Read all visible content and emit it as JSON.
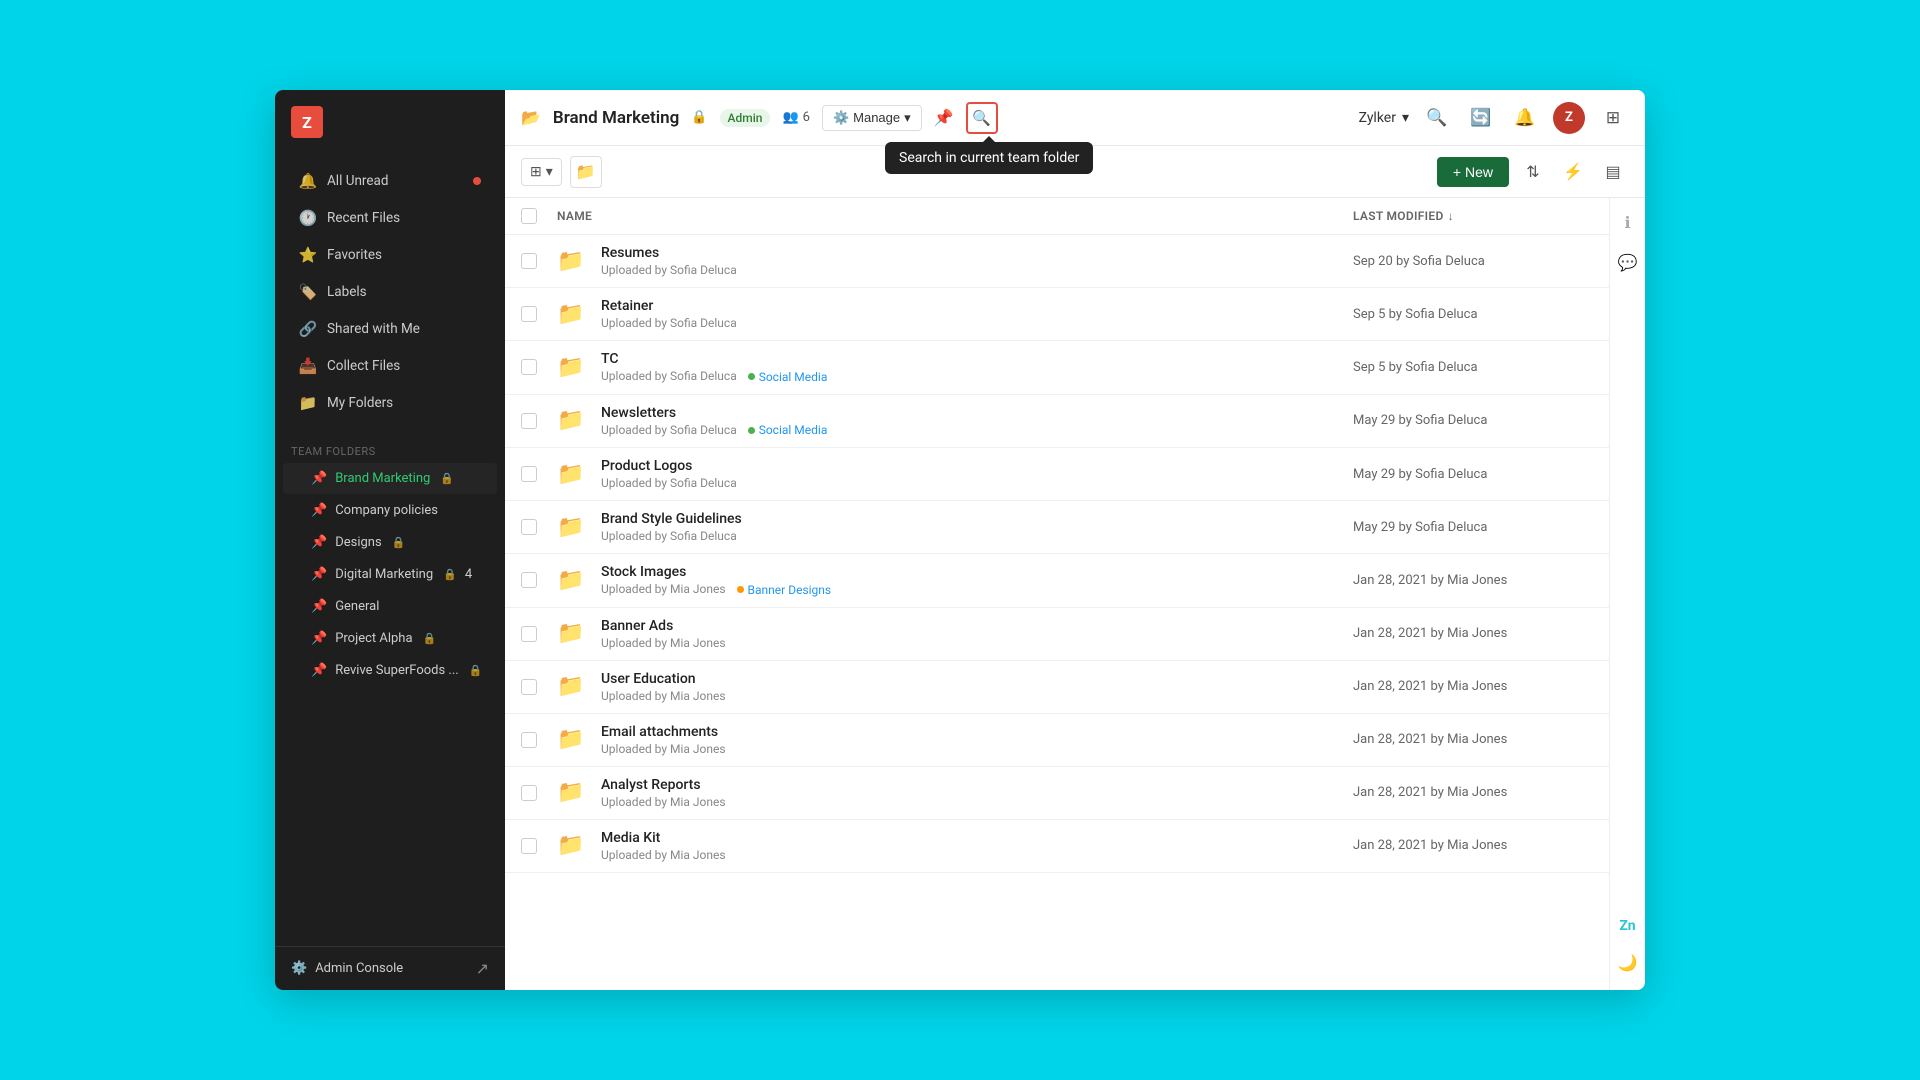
{
  "sidebar": {
    "logo": "Z",
    "nav": [
      {
        "id": "all-unread",
        "label": "All Unread",
        "icon": "🔔",
        "hasDot": true
      },
      {
        "id": "recent-files",
        "label": "Recent Files",
        "icon": "🕐",
        "hasDot": false
      },
      {
        "id": "favorites",
        "label": "Favorites",
        "icon": "⭐",
        "hasDot": false
      },
      {
        "id": "labels",
        "label": "Labels",
        "icon": "🏷️",
        "hasDot": false
      },
      {
        "id": "shared-with-me",
        "label": "Shared with Me",
        "icon": "🔗",
        "hasDot": false
      },
      {
        "id": "collect-files",
        "label": "Collect Files",
        "icon": "📥",
        "hasDot": false
      },
      {
        "id": "my-folders",
        "label": "My Folders",
        "icon": "📁",
        "hasDot": false
      }
    ],
    "team_folders_label": "Team Folders",
    "team_folders": [
      {
        "id": "brand-marketing",
        "label": "Brand Marketing",
        "active": true,
        "hasLock": true,
        "hasBadge": false
      },
      {
        "id": "company-policies",
        "label": "Company policies",
        "active": false,
        "hasLock": false,
        "hasBadge": false
      },
      {
        "id": "designs",
        "label": "Designs",
        "active": false,
        "hasLock": true,
        "hasBadge": false
      },
      {
        "id": "digital-marketing",
        "label": "Digital Marketing",
        "active": false,
        "hasLock": true,
        "hasBadge": true,
        "badge": "4"
      },
      {
        "id": "general",
        "label": "General",
        "active": false,
        "hasLock": false,
        "hasBadge": false
      },
      {
        "id": "project-alpha",
        "label": "Project Alpha",
        "active": false,
        "hasLock": true,
        "hasBadge": false
      },
      {
        "id": "revive-superfoods",
        "label": "Revive SuperFoods ...",
        "active": false,
        "hasLock": true,
        "hasBadge": false
      }
    ],
    "admin_console": "Admin Console"
  },
  "topbar": {
    "folder_name": "Brand Marketing",
    "badge_admin": "Admin",
    "members_count": "6",
    "manage_label": "Manage",
    "user_name": "Zylker",
    "tooltip": "Search in current team folder"
  },
  "actionbar": {
    "new_label": "+ New"
  },
  "file_list": {
    "col_name": "NAME",
    "col_modified": "LAST MODIFIED",
    "files": [
      {
        "name": "Resumes",
        "uploaded_by": "Uploaded by Sofia Deluca",
        "modified": "Sep 20 by Sofia Deluca",
        "tag": null
      },
      {
        "name": "Retainer",
        "uploaded_by": "Uploaded by Sofia Deluca",
        "modified": "Sep 5 by Sofia Deluca",
        "tag": null
      },
      {
        "name": "TC",
        "uploaded_by": "Uploaded by Sofia Deluca",
        "modified": "Sep 5 by Sofia Deluca",
        "tag": "Social Media",
        "tag_color": "green"
      },
      {
        "name": "Newsletters",
        "uploaded_by": "Uploaded by Sofia Deluca",
        "modified": "May 29 by Sofia Deluca",
        "tag": "Social Media",
        "tag_color": "green"
      },
      {
        "name": "Product Logos",
        "uploaded_by": "Uploaded by Sofia Deluca",
        "modified": "May 29 by Sofia Deluca",
        "tag": null
      },
      {
        "name": "Brand Style Guidelines",
        "uploaded_by": "Uploaded by Sofia Deluca",
        "modified": "May 29 by Sofia Deluca",
        "tag": null
      },
      {
        "name": "Stock Images",
        "uploaded_by": "Uploaded by Mia Jones",
        "modified": "Jan 28, 2021 by Mia Jones",
        "tag": "Banner Designs",
        "tag_color": "orange"
      },
      {
        "name": "Banner Ads",
        "uploaded_by": "Uploaded by Mia Jones",
        "modified": "Jan 28, 2021 by Mia Jones",
        "tag": null
      },
      {
        "name": "User Education",
        "uploaded_by": "Uploaded by Mia Jones",
        "modified": "Jan 28, 2021 by Mia Jones",
        "tag": null
      },
      {
        "name": "Email attachments",
        "uploaded_by": "Uploaded by Mia Jones",
        "modified": "Jan 28, 2021 by Mia Jones",
        "tag": null
      },
      {
        "name": "Analyst Reports",
        "uploaded_by": "Uploaded by Mia Jones",
        "modified": "Jan 28, 2021 by Mia Jones",
        "tag": null
      },
      {
        "name": "Media Kit",
        "uploaded_by": "Uploaded by Mia Jones",
        "modified": "Jan 28, 2021 by Mia Jones",
        "tag": null
      }
    ]
  }
}
